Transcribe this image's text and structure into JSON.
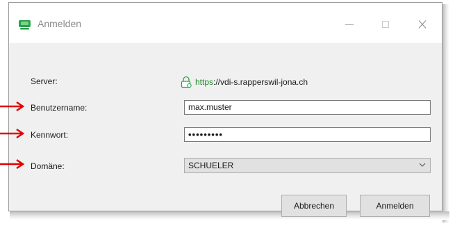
{
  "window": {
    "title": "Anmelden"
  },
  "server": {
    "label": "Server:",
    "url_scheme": "https",
    "url_rest": "://vdi-s.rapperswil-jona.ch"
  },
  "username": {
    "label": "Benutzername:",
    "value": "max.muster"
  },
  "password": {
    "label": "Kennwort:",
    "value": "•••••••••"
  },
  "domain": {
    "label": "Domäne:",
    "selected": "SCHUELER"
  },
  "buttons": {
    "cancel": "Abbrechen",
    "login": "Anmelden"
  },
  "colors": {
    "accent_green": "#1e8c2c",
    "annotation_arrow": "#e00000"
  }
}
